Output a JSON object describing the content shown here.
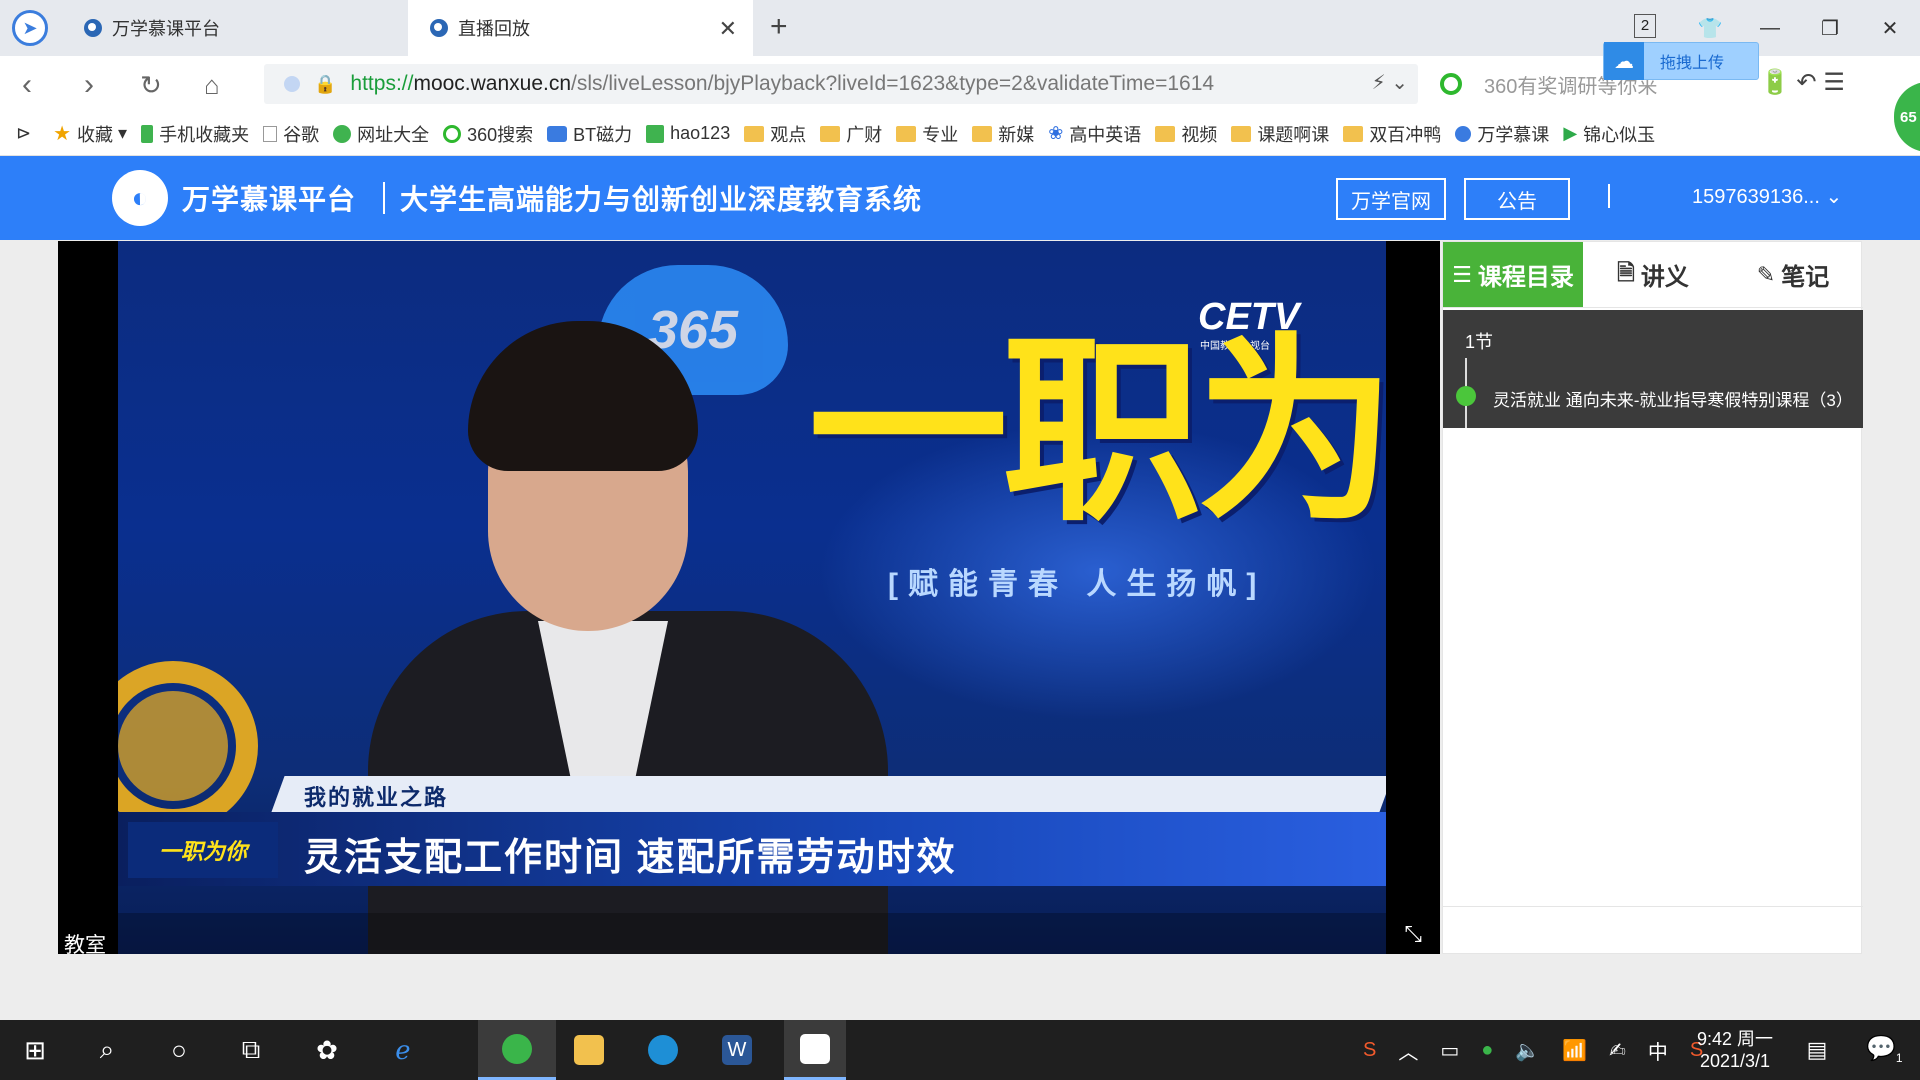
{
  "browser": {
    "tabs": [
      {
        "label": "万学慕课平台"
      },
      {
        "label": "直播回放"
      }
    ],
    "tab_count": "2",
    "upload_label": "拖拽上传",
    "url": {
      "scheme": "https://",
      "host": "mooc.wanxue.cn",
      "path": "/sls/liveLesson/bjyPlayback?liveId=1623&type=2&validateTime=1614"
    },
    "search_placeholder": "360有奖调研等你来",
    "bookmarks": [
      {
        "label": "收藏",
        "icon": "star-icon"
      },
      {
        "label": "手机收藏夹",
        "icon": "phone-icon"
      },
      {
        "label": "谷歌",
        "icon": "page-icon"
      },
      {
        "label": "网址大全",
        "icon": "plus-icon"
      },
      {
        "label": "360搜索",
        "icon": "360-icon"
      },
      {
        "label": "BT磁力",
        "icon": "bt-icon"
      },
      {
        "label": "hao123",
        "icon": "hao-icon"
      },
      {
        "label": "观点",
        "icon": "folder-icon"
      },
      {
        "label": "广财",
        "icon": "folder-icon"
      },
      {
        "label": "专业",
        "icon": "folder-icon"
      },
      {
        "label": "新媒",
        "icon": "folder-icon"
      },
      {
        "label": "高中英语",
        "icon": "paw-icon"
      },
      {
        "label": "视频",
        "icon": "folder-icon"
      },
      {
        "label": "课题啊课",
        "icon": "folder-icon"
      },
      {
        "label": "双百冲鸭",
        "icon": "folder-icon"
      },
      {
        "label": "万学慕课",
        "icon": "site-icon"
      },
      {
        "label": "锦心似玉",
        "icon": "play-icon"
      }
    ],
    "edge_badge": "65"
  },
  "header": {
    "brand": "万学慕课平台",
    "slogan": "大学生高端能力与创新创业深度教育系统",
    "official_site": "万学官网",
    "notice": "公告",
    "user": "1597639136..."
  },
  "video": {
    "cloud_text": "365",
    "channel": "CETV",
    "channel_sub": "中国教育电视台",
    "show_title": "一职为你",
    "tagline": "[赋能青春  人生扬帆]",
    "kicker": "我的就业之路",
    "headline": "灵活支配工作时间 速配所需劳动时效",
    "mini_logo": "一职为你",
    "room_label": "教室"
  },
  "sidebar": {
    "tabs": [
      {
        "label": "课程目录",
        "icon": "list-icon"
      },
      {
        "label": "讲义",
        "icon": "document-icon"
      },
      {
        "label": "笔记",
        "icon": "edit-icon"
      }
    ],
    "chapter": "1节",
    "lesson": "灵活就业 通向未来-就业指导寒假特别课程（3）"
  },
  "taskbar": {
    "ime": "中",
    "time": "9:42 周一",
    "date": "2021/3/1",
    "notif_count": "1"
  }
}
